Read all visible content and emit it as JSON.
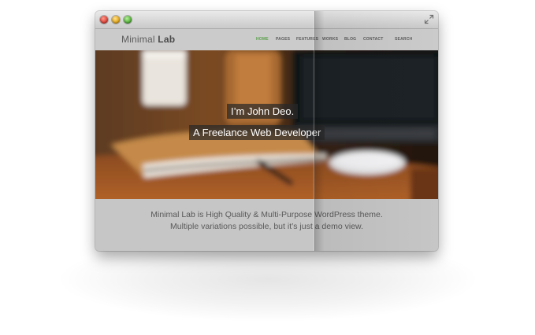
{
  "window": {
    "controls": [
      "close",
      "minimize",
      "maximize"
    ],
    "fullscreen_icon": "fullscreen-arrows-icon"
  },
  "site": {
    "logo_light": "Minimal",
    "logo_bold": "Lab"
  },
  "nav": {
    "items": [
      {
        "label": "HOME",
        "active": true
      },
      {
        "label": "PAGES",
        "active": false
      },
      {
        "label": "FEATURES",
        "active": false
      },
      {
        "label": "WORKS",
        "active": false
      },
      {
        "label": "BLOG",
        "active": false
      },
      {
        "label": "CONTACT",
        "active": false
      },
      {
        "label": "SEARCH",
        "active": false
      }
    ],
    "active_color": "#5aa04a"
  },
  "hero": {
    "line1": "I’m John Deo.",
    "line2": "A Freelance Web Developer"
  },
  "tagline": {
    "line1": "Minimal Lab is High Quality & Multi-Purpose WordPress theme.",
    "line2": "Multiple variations possible, but it’s just a demo view."
  }
}
